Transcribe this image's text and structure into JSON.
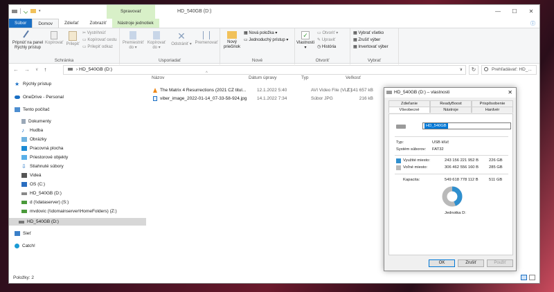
{
  "window": {
    "title": "HD_540GB (D:)",
    "context_tab": "Spravovať",
    "controls": [
      "—",
      "☐",
      "✕"
    ]
  },
  "ribbon_tabs": [
    {
      "label": "Súbor"
    },
    {
      "label": "Domov"
    },
    {
      "label": "Zdieľať"
    },
    {
      "label": "Zobraziť"
    },
    {
      "label": "Nástroje jednotiek"
    }
  ],
  "ribbon": {
    "clipboard": {
      "pin": "Pripnúť na panel Rýchly prístup",
      "copy": "Kopírovať",
      "paste": "Prilepiť",
      "cut": "Vystrihnúť",
      "copy_path": "Kopírovať cestu",
      "paste_shortcut": "Prilepiť odkaz",
      "label": "Schránka"
    },
    "organize": {
      "move": "Premiestniť do",
      "copy_to": "Kopírovať do",
      "delete": "Odstrániť",
      "rename": "Premenovať",
      "label": "Usporiadať"
    },
    "new": {
      "folder": "Nový priečinok",
      "item": "Nová položka",
      "easy_access": "Jednoduchý prístup",
      "label": "Nové"
    },
    "open": {
      "properties": "Vlastnosti",
      "open": "Otvoriť",
      "edit": "Upraviť",
      "history": "História",
      "label": "Otvoriť"
    },
    "select": {
      "all": "Vybrať všetko",
      "none": "Zrušiť výber",
      "invert": "Invertovať výber",
      "label": "Vybrať"
    }
  },
  "address": {
    "path": "HD_540GB (D:)",
    "search_placeholder": "Prehľadávať: HD_..."
  },
  "nav_pane": [
    {
      "label": "Rýchly prístup",
      "icon": "star-icon"
    },
    {
      "label": "OneDrive - Personal",
      "icon": "cloud-icon"
    },
    {
      "label": "Tento počítač",
      "icon": "computer-icon"
    },
    {
      "label": "Dokumenty",
      "icon": "document-icon"
    },
    {
      "label": "Hudba",
      "icon": "music-icon"
    },
    {
      "label": "Obrázky",
      "icon": "pictures-icon"
    },
    {
      "label": "Pracovná plocha",
      "icon": "desktop-icon"
    },
    {
      "label": "Priestorové objekty",
      "icon": "3d-objects-icon"
    },
    {
      "label": "Stiahnuté súbory",
      "icon": "download-icon"
    },
    {
      "label": "Videá",
      "icon": "video-icon"
    },
    {
      "label": "OS (C:)",
      "icon": "drive-icon"
    },
    {
      "label": "HD_540GB (D:)",
      "icon": "drive-icon"
    },
    {
      "label": "d (\\\\dataserver) (S:)",
      "icon": "network-drive-icon"
    },
    {
      "label": "mvdovic (\\\\domainserver\\HomeFolders) (Z:)",
      "icon": "network-drive-icon"
    },
    {
      "label": "HD_540GB (D:)",
      "icon": "drive-icon"
    },
    {
      "label": "Sieť",
      "icon": "network-icon"
    },
    {
      "label": "Catch!",
      "icon": "catch-icon"
    }
  ],
  "columns": [
    "Názov",
    "Dátum úpravy",
    "Typ",
    "Veľkosť"
  ],
  "files": [
    {
      "name": "The Matrix 4 Resurrections (2021 CZ titul...",
      "date": "12.1.2022 5:40",
      "type": "AVI Video File (VLC)",
      "size": "2 141 657 kB",
      "icon": "vlc-icon"
    },
    {
      "name": "viber_image_2022-01-14_07-33-58-924.jpg",
      "date": "14.1.2022 7:34",
      "type": "Súbor JPG",
      "size": "216 kB",
      "icon": "image-file-icon"
    }
  ],
  "status": "Položky: 2",
  "dialog": {
    "title": "HD_540GB (D:) – vlastnosti",
    "tabs_row1": [
      "Zdieľanie",
      "ReadyBoost",
      "Prispôsobenie"
    ],
    "tabs_row2": [
      "Všeobecné",
      "Nástroje",
      "Hardvér"
    ],
    "name_value": "HD_540GB",
    "type_label": "Typ:",
    "type_value": "USB kľúč",
    "fs_label": "Systém súborov:",
    "fs_value": "FAT32",
    "used_label": "Využité miesto:",
    "used_bytes": "243 156 221 952 B",
    "used_gb": "226 GB",
    "free_label": "Voľné miesto:",
    "free_bytes": "306 462 556 160 B",
    "free_gb": "285 GB",
    "cap_label": "Kapacita:",
    "cap_bytes": "549 618 778 112 B",
    "cap_gb": "511 GB",
    "drive_label": "Jednotka D:",
    "used_fraction": 0.442,
    "used_color": "#2f8fce",
    "free_color": "#b9b9b9",
    "buttons": [
      "OK",
      "Zrušiť",
      "Použiť"
    ]
  }
}
